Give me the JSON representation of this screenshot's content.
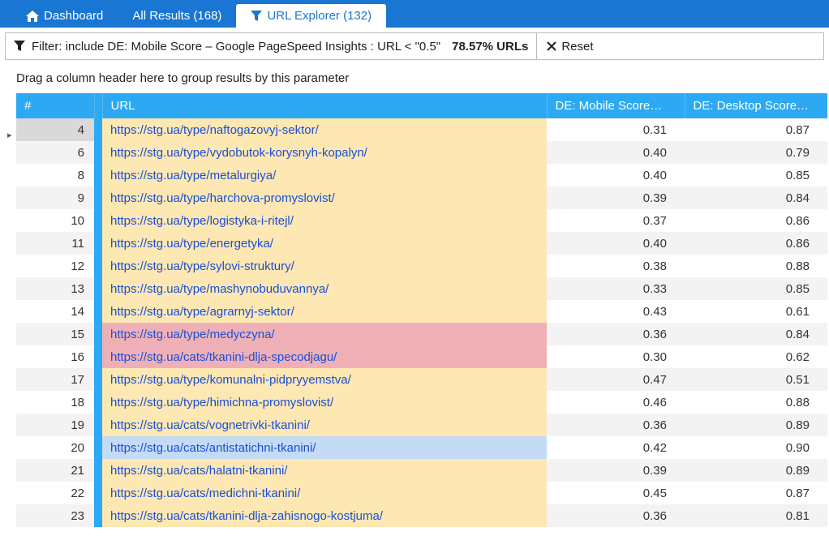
{
  "tabs": {
    "dashboard": "Dashboard",
    "all_results": "All Results (168)",
    "url_explorer": "URL Explorer (132)"
  },
  "filter": {
    "text": "Filter: include DE: Mobile Score  –  Google PageSpeed Insights  :  URL < \"0.5\"",
    "percent": "78.57% URLs",
    "reset": "Reset"
  },
  "group_hint": "Drag a column header here to group results by this parameter",
  "columns": {
    "idx": "#",
    "url": "URL",
    "mobile": "DE: Mobile Score…",
    "desktop": "DE: Desktop Score…"
  },
  "rows": [
    {
      "n": 4,
      "url": "https://stg.ua/type/naftogazovyj-sektor/",
      "m": "0.31",
      "d": "0.87",
      "c": "url-yellow",
      "sel": true
    },
    {
      "n": 6,
      "url": "https://stg.ua/type/vydobutok-korysnyh-kopalyn/",
      "m": "0.40",
      "d": "0.79",
      "c": "url-yellow"
    },
    {
      "n": 8,
      "url": "https://stg.ua/type/metalurgiya/",
      "m": "0.40",
      "d": "0.85",
      "c": "url-yellow"
    },
    {
      "n": 9,
      "url": "https://stg.ua/type/harchova-promyslovist/",
      "m": "0.39",
      "d": "0.84",
      "c": "url-yellow"
    },
    {
      "n": 10,
      "url": "https://stg.ua/type/logistyka-i-ritejl/",
      "m": "0.37",
      "d": "0.86",
      "c": "url-yellow"
    },
    {
      "n": 11,
      "url": "https://stg.ua/type/energetyka/",
      "m": "0.40",
      "d": "0.86",
      "c": "url-yellow"
    },
    {
      "n": 12,
      "url": "https://stg.ua/type/sylovi-struktury/",
      "m": "0.38",
      "d": "0.88",
      "c": "url-yellow"
    },
    {
      "n": 13,
      "url": "https://stg.ua/type/mashynobuduvannya/",
      "m": "0.33",
      "d": "0.85",
      "c": "url-yellow"
    },
    {
      "n": 14,
      "url": "https://stg.ua/type/agrarnyj-sektor/",
      "m": "0.43",
      "d": "0.61",
      "c": "url-yellow"
    },
    {
      "n": 15,
      "url": "https://stg.ua/type/medyczyna/",
      "m": "0.36",
      "d": "0.84",
      "c": "url-red"
    },
    {
      "n": 16,
      "url": "https://stg.ua/cats/tkanini-dlja-specodjagu/",
      "m": "0.30",
      "d": "0.62",
      "c": "url-red"
    },
    {
      "n": 17,
      "url": "https://stg.ua/type/komunalni-pidpryyemstva/",
      "m": "0.47",
      "d": "0.51",
      "c": "url-yellow"
    },
    {
      "n": 18,
      "url": "https://stg.ua/type/himichna-promyslovist/",
      "m": "0.46",
      "d": "0.88",
      "c": "url-yellow"
    },
    {
      "n": 19,
      "url": "https://stg.ua/cats/vognetrivki-tkanini/",
      "m": "0.36",
      "d": "0.89",
      "c": "url-yellow"
    },
    {
      "n": 20,
      "url": "https://stg.ua/cats/antistatichni-tkanini/",
      "m": "0.42",
      "d": "0.90",
      "c": "url-blue"
    },
    {
      "n": 21,
      "url": "https://stg.ua/cats/halatni-tkanini/",
      "m": "0.39",
      "d": "0.89",
      "c": "url-yellow"
    },
    {
      "n": 22,
      "url": "https://stg.ua/cats/medichni-tkanini/",
      "m": "0.45",
      "d": "0.87",
      "c": "url-yellow"
    },
    {
      "n": 23,
      "url": "https://stg.ua/cats/tkanini-dlja-zahisnogo-kostjuma/",
      "m": "0.36",
      "d": "0.81",
      "c": "url-yellow"
    }
  ]
}
